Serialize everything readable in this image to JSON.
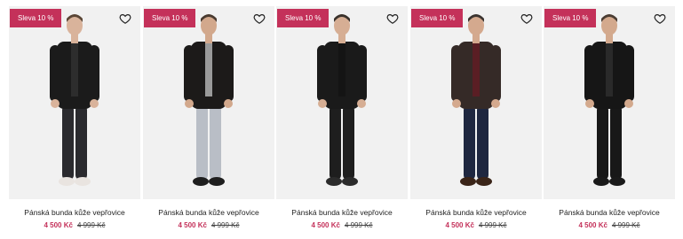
{
  "products": [
    {
      "badge": "Sleva 10 %",
      "name": "Pánská bunda kůže vepřovice",
      "price_new": "4 500 Kč",
      "price_old": "4 999 Kč",
      "icon": "heart-outline-icon",
      "colors": {
        "jacket": "#1b1b1b",
        "pants": "#2a2a2e",
        "shoes": "#e9e4e0",
        "skin": "#d9b39b",
        "hair": "#5a4636",
        "shirt": "#2d2d2d"
      }
    },
    {
      "badge": "Sleva 10 %",
      "name": "Pánská bunda kůže vepřovice",
      "price_new": "4 500 Kč",
      "price_old": "4 999 Kč",
      "icon": "heart-outline-icon",
      "colors": {
        "jacket": "#1c1a19",
        "pants": "#b9bec6",
        "shoes": "#1e1e1e",
        "skin": "#d2a88c",
        "hair": "#4a3b30",
        "shirt": "#9a9a9a"
      }
    },
    {
      "badge": "Sleva 10 %",
      "name": "Pánská bunda kůže vepřovice",
      "price_new": "4 500 Kč",
      "price_old": "4 999 Kč",
      "icon": "heart-outline-icon",
      "colors": {
        "jacket": "#1a1a1a",
        "pants": "#1e1e1e",
        "shoes": "#2b2b2b",
        "skin": "#d6ae94",
        "hair": "#3a322c",
        "shirt": "#141414"
      }
    },
    {
      "badge": "Sleva 10 %",
      "name": "Pánská bunda kůže vepřovice",
      "price_new": "4 500 Kč",
      "price_old": "4 999 Kč",
      "icon": "heart-outline-icon",
      "colors": {
        "jacket": "#352a27",
        "pants": "#1f2740",
        "shoes": "#3a2418",
        "skin": "#d4a98e",
        "hair": "#3b3430",
        "shirt": "#5a1e24"
      }
    },
    {
      "badge": "Sleva 10 %",
      "name": "Pánská bunda kůže vepřovice",
      "price_new": "4 500 Kč",
      "price_old": "4 999 Kč",
      "icon": "heart-outline-icon",
      "colors": {
        "jacket": "#161616",
        "pants": "#181818",
        "shoes": "#1a1a1a",
        "skin": "#d3a98d",
        "hair": "#4b3d33",
        "shirt": "#2a2a2a"
      }
    }
  ],
  "accent_color": "#c4315a"
}
